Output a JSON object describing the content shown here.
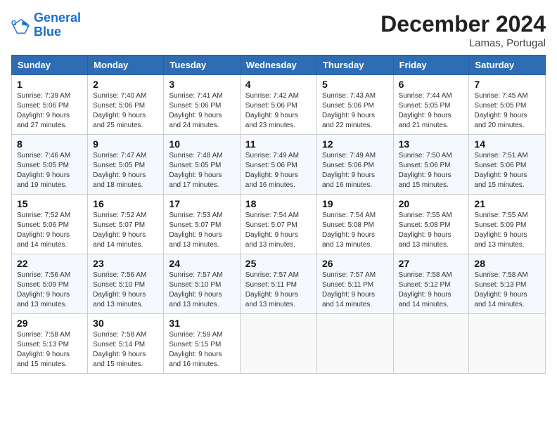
{
  "logo": {
    "line1": "General",
    "line2": "Blue"
  },
  "title": "December 2024",
  "location": "Lamas, Portugal",
  "days_header": [
    "Sunday",
    "Monday",
    "Tuesday",
    "Wednesday",
    "Thursday",
    "Friday",
    "Saturday"
  ],
  "weeks": [
    [
      {
        "day": "1",
        "detail": "Sunrise: 7:39 AM\nSunset: 5:06 PM\nDaylight: 9 hours\nand 27 minutes."
      },
      {
        "day": "2",
        "detail": "Sunrise: 7:40 AM\nSunset: 5:06 PM\nDaylight: 9 hours\nand 25 minutes."
      },
      {
        "day": "3",
        "detail": "Sunrise: 7:41 AM\nSunset: 5:06 PM\nDaylight: 9 hours\nand 24 minutes."
      },
      {
        "day": "4",
        "detail": "Sunrise: 7:42 AM\nSunset: 5:06 PM\nDaylight: 9 hours\nand 23 minutes."
      },
      {
        "day": "5",
        "detail": "Sunrise: 7:43 AM\nSunset: 5:06 PM\nDaylight: 9 hours\nand 22 minutes."
      },
      {
        "day": "6",
        "detail": "Sunrise: 7:44 AM\nSunset: 5:05 PM\nDaylight: 9 hours\nand 21 minutes."
      },
      {
        "day": "7",
        "detail": "Sunrise: 7:45 AM\nSunset: 5:05 PM\nDaylight: 9 hours\nand 20 minutes."
      }
    ],
    [
      {
        "day": "8",
        "detail": "Sunrise: 7:46 AM\nSunset: 5:05 PM\nDaylight: 9 hours\nand 19 minutes."
      },
      {
        "day": "9",
        "detail": "Sunrise: 7:47 AM\nSunset: 5:05 PM\nDaylight: 9 hours\nand 18 minutes."
      },
      {
        "day": "10",
        "detail": "Sunrise: 7:48 AM\nSunset: 5:05 PM\nDaylight: 9 hours\nand 17 minutes."
      },
      {
        "day": "11",
        "detail": "Sunrise: 7:49 AM\nSunset: 5:06 PM\nDaylight: 9 hours\nand 16 minutes."
      },
      {
        "day": "12",
        "detail": "Sunrise: 7:49 AM\nSunset: 5:06 PM\nDaylight: 9 hours\nand 16 minutes."
      },
      {
        "day": "13",
        "detail": "Sunrise: 7:50 AM\nSunset: 5:06 PM\nDaylight: 9 hours\nand 15 minutes."
      },
      {
        "day": "14",
        "detail": "Sunrise: 7:51 AM\nSunset: 5:06 PM\nDaylight: 9 hours\nand 15 minutes."
      }
    ],
    [
      {
        "day": "15",
        "detail": "Sunrise: 7:52 AM\nSunset: 5:06 PM\nDaylight: 9 hours\nand 14 minutes."
      },
      {
        "day": "16",
        "detail": "Sunrise: 7:52 AM\nSunset: 5:07 PM\nDaylight: 9 hours\nand 14 minutes."
      },
      {
        "day": "17",
        "detail": "Sunrise: 7:53 AM\nSunset: 5:07 PM\nDaylight: 9 hours\nand 13 minutes."
      },
      {
        "day": "18",
        "detail": "Sunrise: 7:54 AM\nSunset: 5:07 PM\nDaylight: 9 hours\nand 13 minutes."
      },
      {
        "day": "19",
        "detail": "Sunrise: 7:54 AM\nSunset: 5:08 PM\nDaylight: 9 hours\nand 13 minutes."
      },
      {
        "day": "20",
        "detail": "Sunrise: 7:55 AM\nSunset: 5:08 PM\nDaylight: 9 hours\nand 13 minutes."
      },
      {
        "day": "21",
        "detail": "Sunrise: 7:55 AM\nSunset: 5:09 PM\nDaylight: 9 hours\nand 13 minutes."
      }
    ],
    [
      {
        "day": "22",
        "detail": "Sunrise: 7:56 AM\nSunset: 5:09 PM\nDaylight: 9 hours\nand 13 minutes."
      },
      {
        "day": "23",
        "detail": "Sunrise: 7:56 AM\nSunset: 5:10 PM\nDaylight: 9 hours\nand 13 minutes."
      },
      {
        "day": "24",
        "detail": "Sunrise: 7:57 AM\nSunset: 5:10 PM\nDaylight: 9 hours\nand 13 minutes."
      },
      {
        "day": "25",
        "detail": "Sunrise: 7:57 AM\nSunset: 5:11 PM\nDaylight: 9 hours\nand 13 minutes."
      },
      {
        "day": "26",
        "detail": "Sunrise: 7:57 AM\nSunset: 5:11 PM\nDaylight: 9 hours\nand 14 minutes."
      },
      {
        "day": "27",
        "detail": "Sunrise: 7:58 AM\nSunset: 5:12 PM\nDaylight: 9 hours\nand 14 minutes."
      },
      {
        "day": "28",
        "detail": "Sunrise: 7:58 AM\nSunset: 5:13 PM\nDaylight: 9 hours\nand 14 minutes."
      }
    ],
    [
      {
        "day": "29",
        "detail": "Sunrise: 7:58 AM\nSunset: 5:13 PM\nDaylight: 9 hours\nand 15 minutes."
      },
      {
        "day": "30",
        "detail": "Sunrise: 7:58 AM\nSunset: 5:14 PM\nDaylight: 9 hours\nand 15 minutes."
      },
      {
        "day": "31",
        "detail": "Sunrise: 7:59 AM\nSunset: 5:15 PM\nDaylight: 9 hours\nand 16 minutes."
      },
      {
        "day": "",
        "detail": ""
      },
      {
        "day": "",
        "detail": ""
      },
      {
        "day": "",
        "detail": ""
      },
      {
        "day": "",
        "detail": ""
      }
    ]
  ]
}
